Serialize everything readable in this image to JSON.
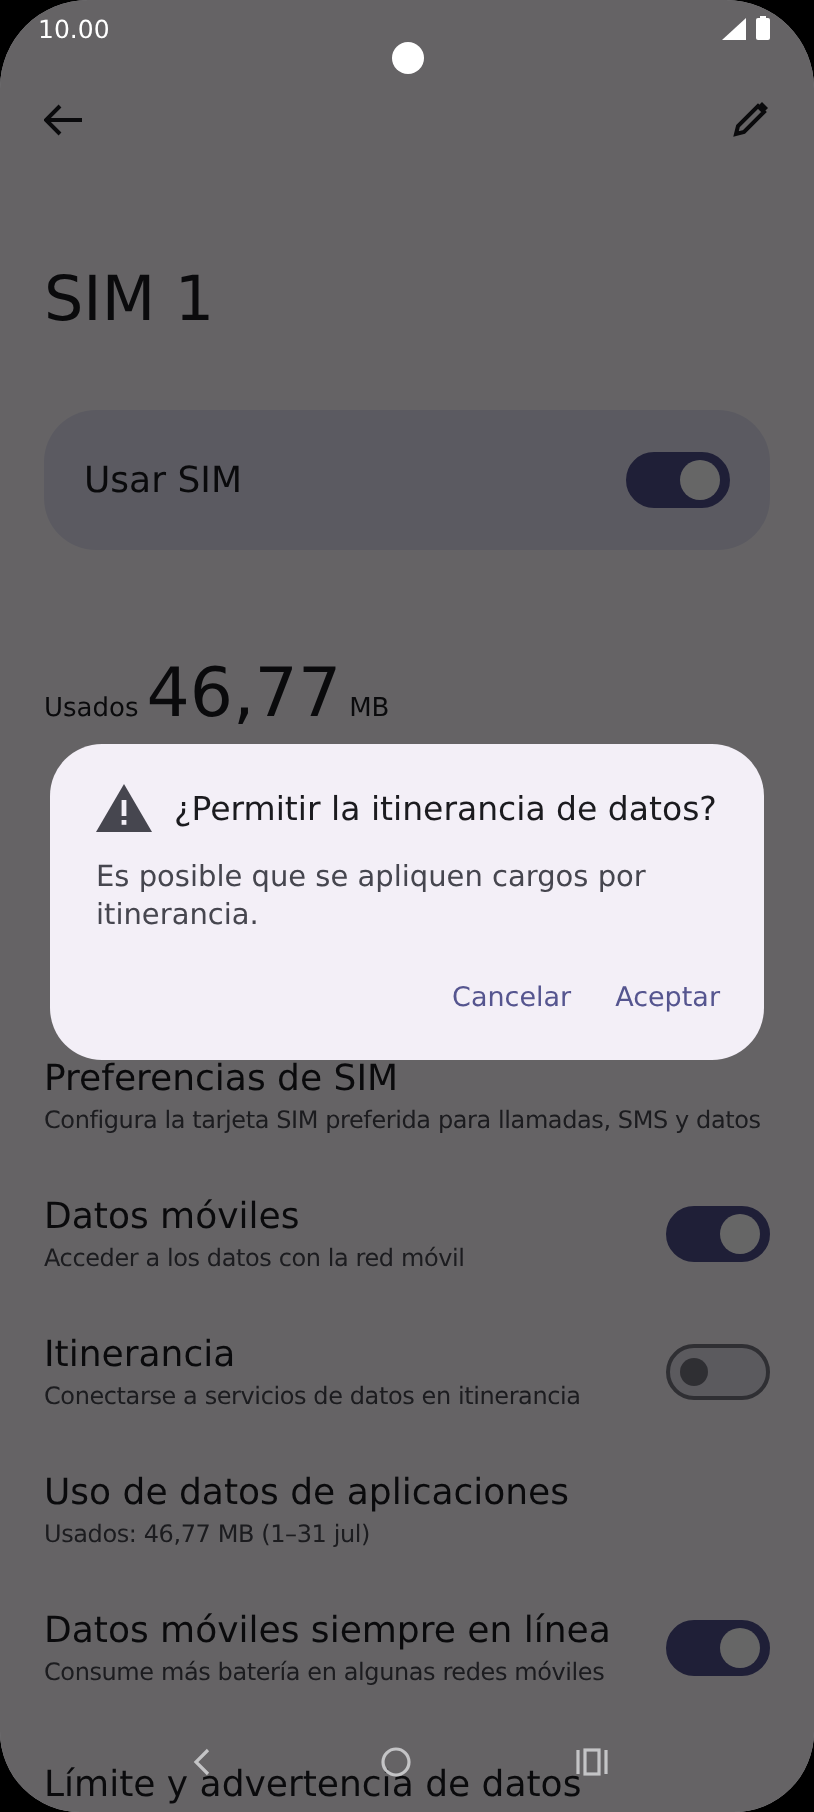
{
  "status_bar": {
    "time": "10.00"
  },
  "title": "SIM 1",
  "sim_card": {
    "label": "Usar SIM",
    "on": true
  },
  "usage": {
    "label": "Usados",
    "amount": "46,77",
    "unit": "MB"
  },
  "settings": [
    {
      "title": "Preferencias de SIM",
      "subtitle": "Configura la tarjeta SIM preferida para llamadas, SMS y datos",
      "kind": "link"
    },
    {
      "title": "Datos móviles",
      "subtitle": "Acceder a los datos con la red móvil",
      "kind": "switch",
      "on": true
    },
    {
      "title": "Itinerancia",
      "subtitle": "Conectarse a servicios de datos en itinerancia",
      "kind": "switch",
      "on": false
    },
    {
      "title": "Uso de datos de aplicaciones",
      "subtitle": "Usados: 46,77 MB (1–31 jul)",
      "kind": "link"
    },
    {
      "title": "Datos móviles siempre en línea",
      "subtitle": "Consume más batería en algunas redes móviles",
      "kind": "switch",
      "on": true
    },
    {
      "title": "Límite y advertencia de datos",
      "kind": "link"
    }
  ],
  "dialog": {
    "title": "¿Permitir la itinerancia de datos?",
    "message": "Es posible que se apliquen cargos por itinerancia.",
    "buttons": [
      "Cancelar",
      "Aceptar"
    ]
  }
}
